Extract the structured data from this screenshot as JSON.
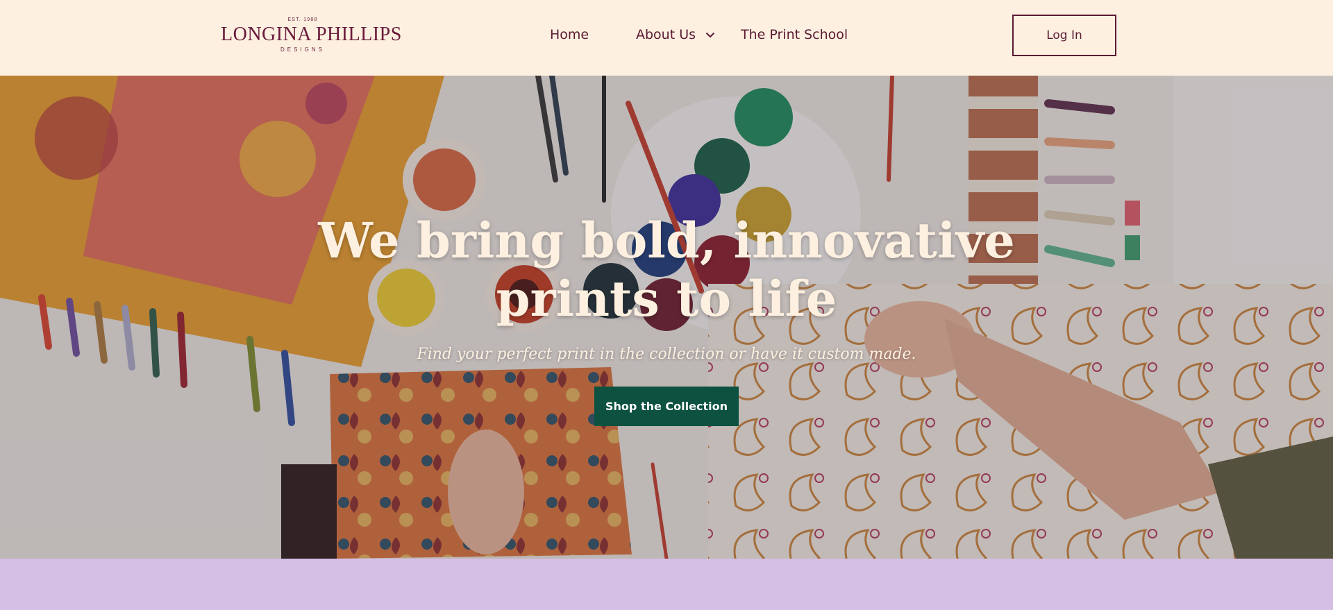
{
  "header": {
    "logo": {
      "est": "EST. 1988",
      "name": "LONGINA PHILLIPS",
      "sub": "DESIGNS"
    },
    "nav": {
      "home": "Home",
      "about": "About Us",
      "print_school": "The Print School"
    },
    "login_label": "Log In"
  },
  "hero": {
    "title": "We bring bold, innovative prints to life",
    "subtitle": "Find your perfect print in the collection or have it custom made.",
    "cta_label": "Shop the Collection"
  },
  "colors": {
    "header_bg": "#fdf0e0",
    "brand_maroon": "#6b1a3b",
    "cta_green": "#0d5240",
    "band_lilac": "#d5bfe4"
  },
  "icons": {
    "about_dropdown": "chevron-down-icon"
  }
}
